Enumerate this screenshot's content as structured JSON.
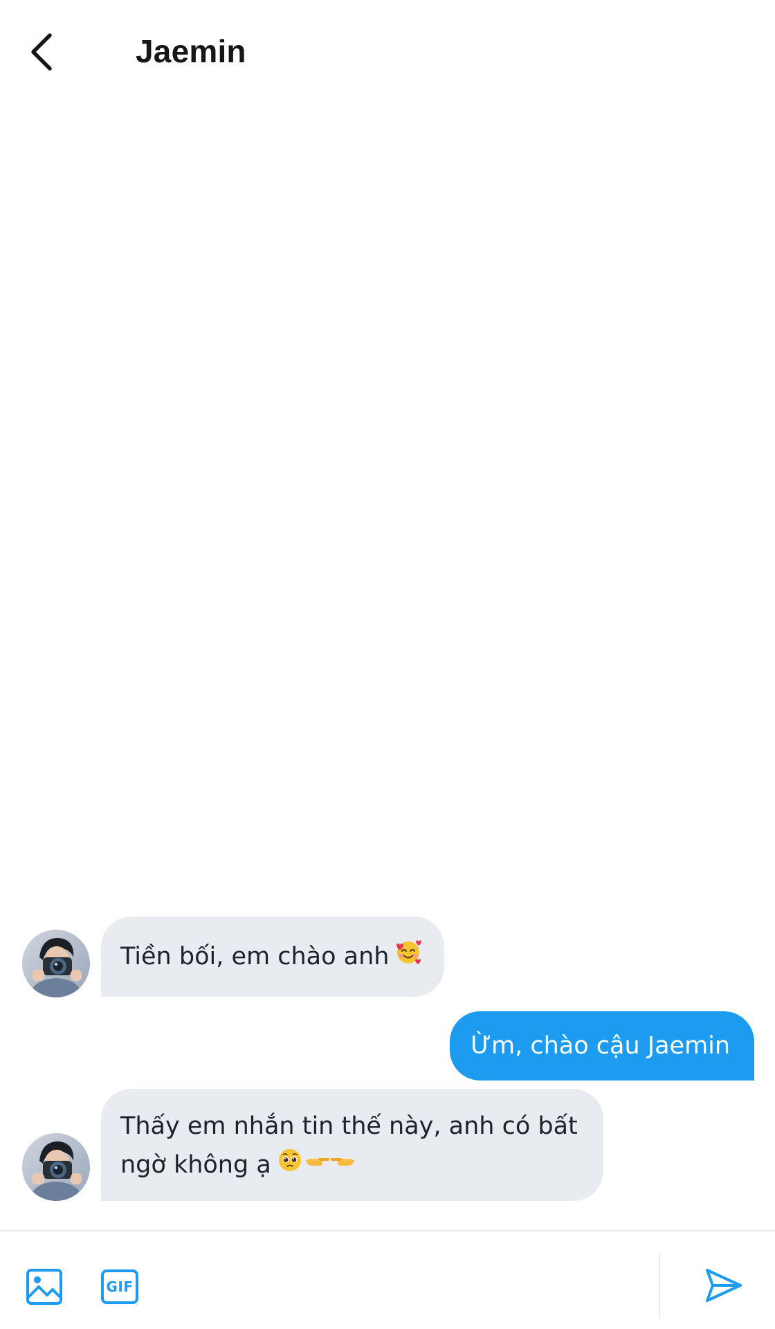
{
  "header": {
    "back_icon": "chevron-left-icon",
    "title": "Jaemin"
  },
  "conversation": {
    "messages": [
      {
        "sender": "other",
        "text": "Tiền bối, em chào anh",
        "emoji": "smiling-face-with-hearts"
      },
      {
        "sender": "me",
        "text": "Ừm, chào cậu Jaemin"
      },
      {
        "sender": "other",
        "text": "Thấy em nhắn tin thế này, anh có bất ngờ không ạ",
        "emoji": "pleading-face-and-pointing-fingers"
      }
    ]
  },
  "composer": {
    "image_icon": "image-icon",
    "gif_label": "GIF",
    "send_icon": "send-icon",
    "input_value": ""
  },
  "colors": {
    "accent": "#1d9bf0",
    "incoming_bubble": "#e8ebef",
    "outgoing_text": "#ffffff",
    "background": "#ffffff"
  }
}
